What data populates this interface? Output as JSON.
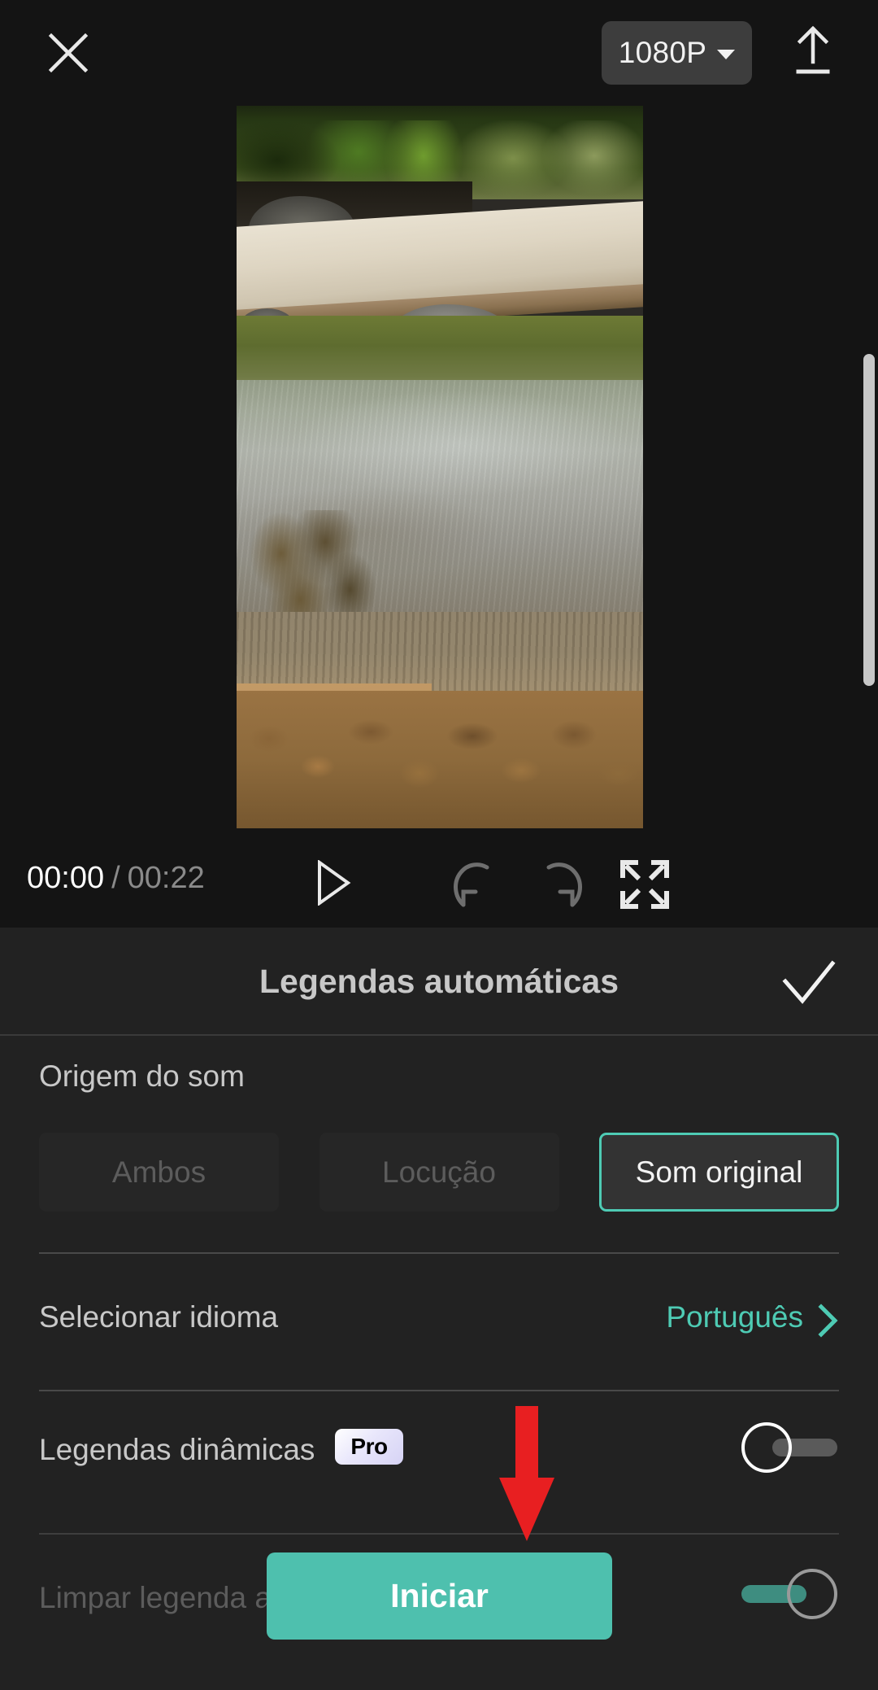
{
  "topbar": {
    "close_icon": "close-icon",
    "quality_label": "1080P",
    "quality_caret_icon": "chevron-down-icon",
    "export_icon": "upload-icon"
  },
  "preview": {
    "scrollbar_icon": "vertical-scrollbar"
  },
  "playback": {
    "current_time": "00:00",
    "separator": "/",
    "total_time": "00:22",
    "play_icon": "play-icon",
    "undo_icon": "undo-icon",
    "redo_icon": "redo-icon",
    "fullscreen_icon": "fullscreen-icon"
  },
  "panel": {
    "title": "Legendas automáticas",
    "confirm_icon": "check-icon",
    "sound_source": {
      "label": "Origem do som",
      "options": [
        {
          "label": "Ambos",
          "selected": false
        },
        {
          "label": "Locução",
          "selected": false
        },
        {
          "label": "Som original",
          "selected": true
        }
      ]
    },
    "language": {
      "label": "Selecionar idioma",
      "value": "Português",
      "chevron_icon": "chevron-right-icon"
    },
    "dynamic_captions": {
      "label": "Legendas dinâmicas",
      "badge": "Pro",
      "toggle_state": "off"
    },
    "clear_previous": {
      "label": "Limpar legenda anterior",
      "toggle_state": "on"
    },
    "start_button": "Iniciar"
  },
  "annotation": {
    "arrow_icon": "red-down-arrow-icon"
  },
  "colors": {
    "accent": "#4ecbb4",
    "accent_button": "#4ec0ae",
    "annotation_red": "#e81f21",
    "panel_bg": "#222222",
    "app_bg": "#141414"
  }
}
